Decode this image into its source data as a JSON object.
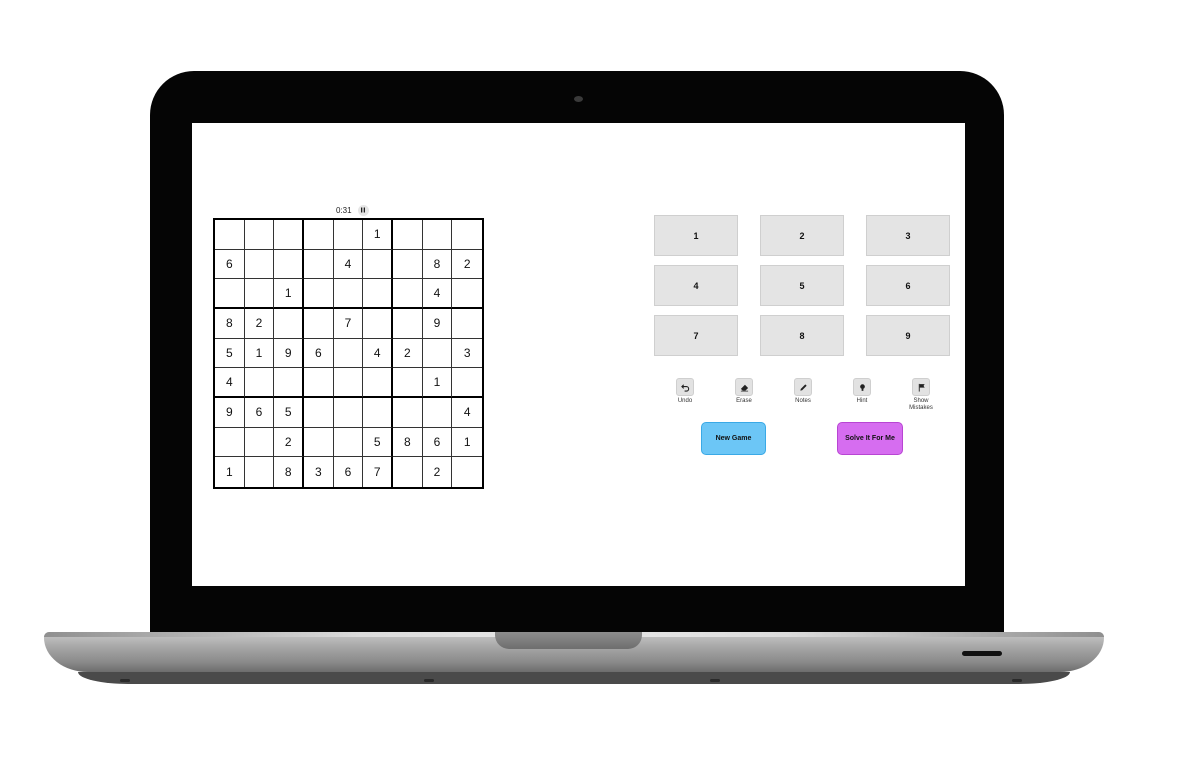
{
  "timer": {
    "elapsed": "0:31",
    "pause_icon": "pause-icon"
  },
  "board": [
    [
      "",
      "",
      "",
      "",
      "",
      "1",
      "",
      "",
      ""
    ],
    [
      "6",
      "",
      "",
      "",
      "4",
      "",
      "",
      "8",
      "2"
    ],
    [
      "",
      "",
      "1",
      "",
      "",
      "",
      "",
      "4",
      ""
    ],
    [
      "8",
      "2",
      "",
      "",
      "7",
      "",
      "",
      "9",
      ""
    ],
    [
      "5",
      "1",
      "9",
      "6",
      "",
      "4",
      "2",
      "",
      "3"
    ],
    [
      "4",
      "",
      "",
      "",
      "",
      "",
      "",
      "1",
      ""
    ],
    [
      "9",
      "6",
      "5",
      "",
      "",
      "",
      "",
      "",
      "4"
    ],
    [
      "",
      "",
      "2",
      "",
      "",
      "5",
      "8",
      "6",
      "1"
    ],
    [
      "1",
      "",
      "8",
      "3",
      "6",
      "7",
      "",
      "2",
      ""
    ]
  ],
  "numpad": [
    "1",
    "2",
    "3",
    "4",
    "5",
    "6",
    "7",
    "8",
    "9"
  ],
  "tools": [
    {
      "id": "undo",
      "label": "Undo",
      "icon": "undo-icon"
    },
    {
      "id": "erase",
      "label": "Erase",
      "icon": "eraser-icon"
    },
    {
      "id": "notes",
      "label": "Notes",
      "icon": "pencil-icon"
    },
    {
      "id": "hint",
      "label": "Hint",
      "icon": "lightbulb-icon"
    },
    {
      "id": "show-mistakes",
      "label": "Show Mistakes",
      "icon": "flag-icon"
    }
  ],
  "actions": {
    "new_game": "New Game",
    "solve": "Solve It For Me"
  },
  "colors": {
    "new_game_bg": "#6cc6f6",
    "solve_bg": "#d66df0",
    "numpad_bg": "#e4e4e4",
    "laptop_bezel": "#050505"
  }
}
